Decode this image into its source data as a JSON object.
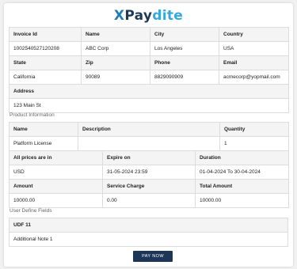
{
  "brand": {
    "part1": "X",
    "part2": "Pay",
    "part3": "dite"
  },
  "invoice": {
    "headers1": [
      "Invoice Id",
      "Name",
      "City",
      "Country"
    ],
    "values1": [
      "1002540527120208",
      "ABC Corp",
      "Los Angeles",
      "USA"
    ],
    "headers2": [
      "State",
      "Zip",
      "Phone",
      "Email"
    ],
    "values2": [
      "California",
      "90089",
      "8829090909",
      "acmecorp@yopmail.com"
    ],
    "address_label": "Address",
    "address_value": "123 Main St"
  },
  "product": {
    "section_title": "Product Information",
    "headers": [
      "Name",
      "Description",
      "Quantity"
    ],
    "values": [
      "Platform License",
      "",
      "1"
    ],
    "headers2": [
      "All prices are in",
      "Expire on",
      "Duration"
    ],
    "values2": [
      "USD",
      "31-05-2024 23:59",
      "01-04-2024 To 30-04-2024"
    ],
    "headers3": [
      "Amount",
      "Service Charge",
      "Total Amount"
    ],
    "values3": [
      "10000.00",
      "0.00",
      "10000.00"
    ]
  },
  "udf": {
    "section_title": "User Define Fields",
    "label": "UDF 11",
    "value": "Additional Note 1"
  },
  "actions": {
    "pay_now": "PAY NOW"
  },
  "colors": {
    "button": "#1d3557",
    "logo_x": "#1f7fb6",
    "logo_pay": "#1e3a56",
    "logo_dite": "#35a9d9"
  }
}
